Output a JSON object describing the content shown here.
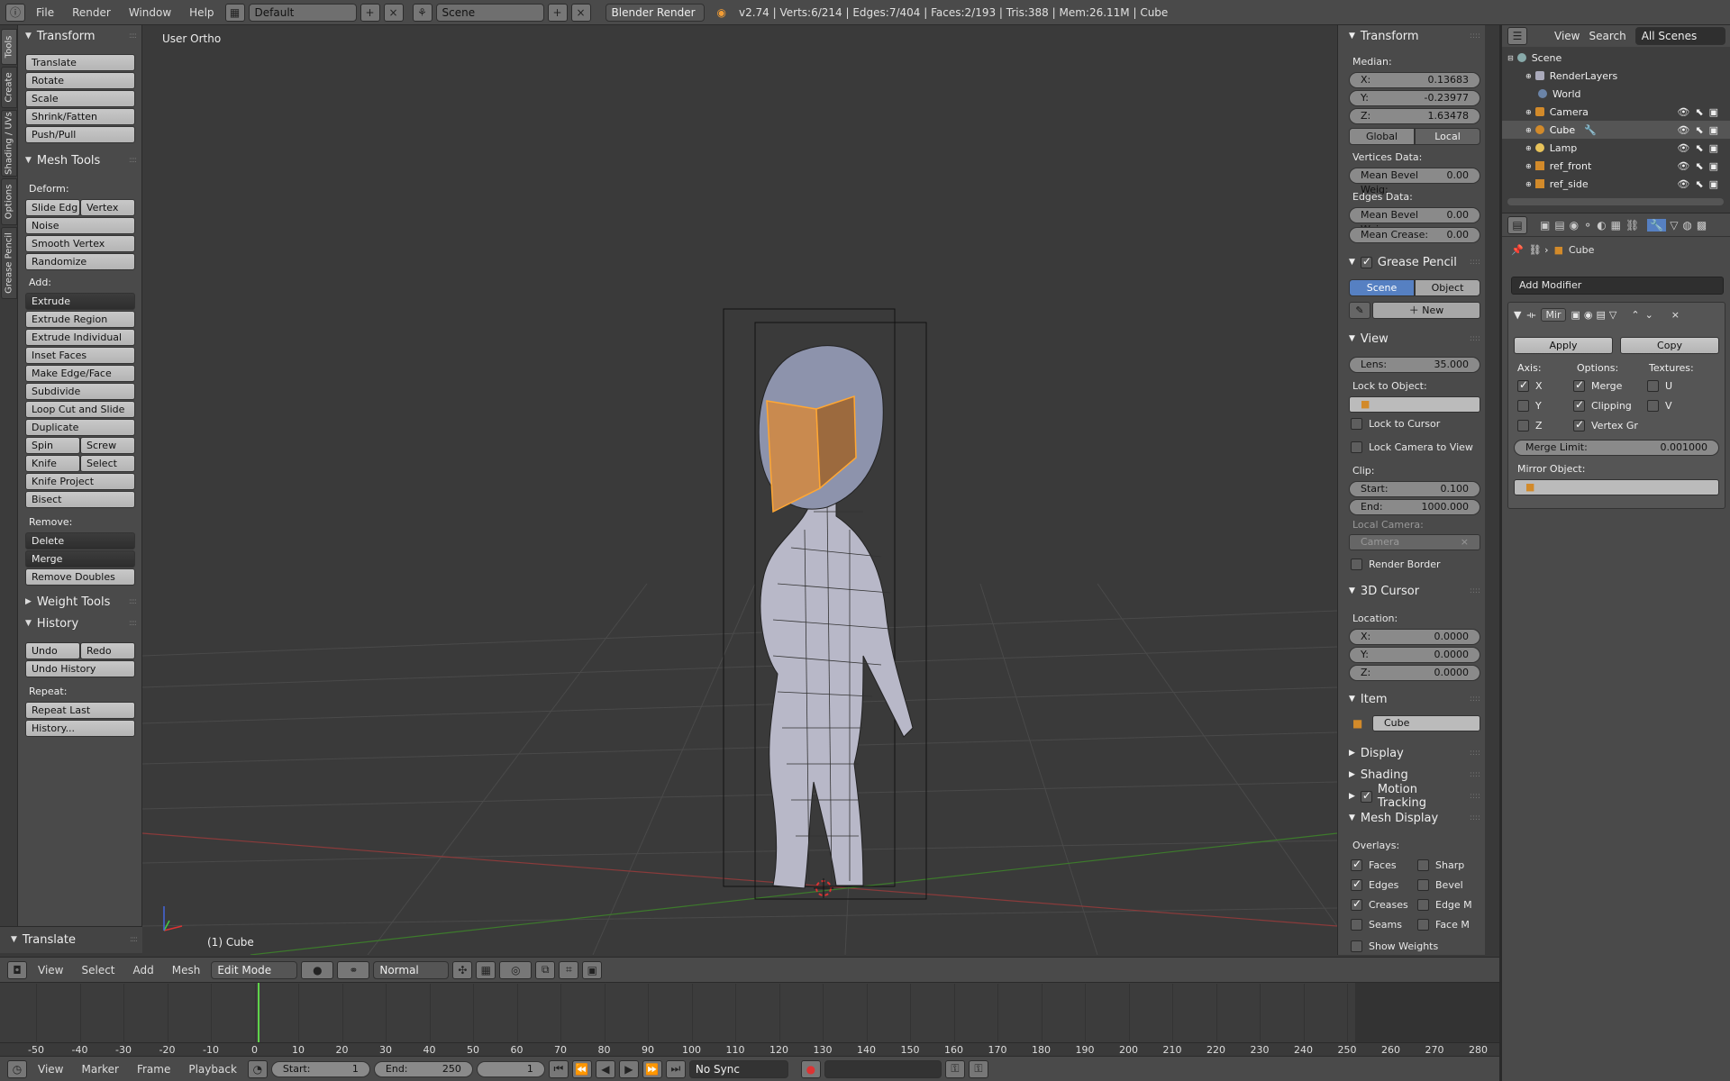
{
  "topbar": {
    "menus": [
      "File",
      "Render",
      "Window",
      "Help"
    ],
    "layout": "Default",
    "scene": "Scene",
    "engine": "Blender Render",
    "stats": "v2.74 | Verts:6/214 | Edges:7/404 | Faces:2/193 | Tris:388 | Mem:26.11M | Cube"
  },
  "left_tabs": [
    "Tools",
    "Create",
    "Shading / UVs",
    "Options",
    "Grease Pencil"
  ],
  "toolshelf": {
    "transform_title": "Transform",
    "transform": [
      "Translate",
      "Rotate",
      "Scale",
      "Shrink/Fatten",
      "Push/Pull"
    ],
    "mesh_tools_title": "Mesh Tools",
    "deform_label": "Deform:",
    "slide_edge": "Slide Edg",
    "vertex": "Vertex",
    "noise": "Noise",
    "smooth_vertex": "Smooth Vertex",
    "randomize": "Randomize",
    "add_label": "Add:",
    "extrude": "Extrude",
    "add_items": [
      "Extrude Region",
      "Extrude Individual",
      "Inset Faces",
      "Make Edge/Face",
      "Subdivide",
      "Loop Cut and Slide",
      "Duplicate"
    ],
    "spin": "Spin",
    "screw": "Screw",
    "knife": "Knife",
    "select": "Select",
    "knife_project": "Knife Project",
    "bisect": "Bisect",
    "remove_label": "Remove:",
    "delete": "Delete",
    "merge": "Merge",
    "remove_doubles": "Remove Doubles",
    "weight_tools_title": "Weight Tools",
    "history_title": "History",
    "undo": "Undo",
    "redo": "Redo",
    "undo_history": "Undo History",
    "repeat_label": "Repeat:",
    "repeat_last": "Repeat Last",
    "history_more": "History...",
    "operator_title": "Translate"
  },
  "viewport": {
    "view_label": "User Ortho",
    "object_label": "(1) Cube"
  },
  "npanel": {
    "transform_title": "Transform",
    "median_label": "Median:",
    "x_label": "X:",
    "x": "0.13683",
    "y_label": "Y:",
    "y": "-0.23977",
    "z_label": "Z:",
    "z": "1.63478",
    "global": "Global",
    "local": "Local",
    "vertices_data": "Vertices Data:",
    "v_bevel_label": "Mean Bevel Weig:",
    "v_bevel": "0.00",
    "edges_data": "Edges Data:",
    "e_bevel_label": "Mean Bevel Weig:",
    "e_bevel": "0.00",
    "crease_label": "Mean Crease:",
    "crease": "0.00",
    "grease_title": "Grease Pencil",
    "gp_scene": "Scene",
    "gp_object": "Object",
    "gp_new": "New",
    "view_title": "View",
    "lens_label": "Lens:",
    "lens": "35.000",
    "lock_obj": "Lock to Object:",
    "lock_cursor": "Lock to Cursor",
    "lock_camera": "Lock Camera to View",
    "clip_label": "Clip:",
    "start_label": "Start:",
    "start": "0.100",
    "end_label": "End:",
    "end": "1000.000",
    "local_camera": "Local Camera:",
    "camera": "Camera",
    "render_border": "Render Border",
    "cursor_title": "3D Cursor",
    "location_label": "Location:",
    "cx_label": "X:",
    "cx": "0.0000",
    "cy_label": "Y:",
    "cy": "0.0000",
    "cz_label": "Z:",
    "cz": "0.0000",
    "item_title": "Item",
    "item_name": "Cube",
    "display_title": "Display",
    "shading_title": "Shading",
    "motion_title": "Motion Tracking",
    "mesh_display_title": "Mesh Display",
    "overlays_label": "Overlays:",
    "faces": "Faces",
    "sharp": "Sharp",
    "edges": "Edges",
    "bevel": "Bevel",
    "creases": "Creases",
    "edge_m": "Edge M",
    "seams": "Seams",
    "face_m": "Face M",
    "show_weights": "Show Weights"
  },
  "outliner": {
    "view": "View",
    "search": "Search",
    "filter": "All Scenes",
    "items": [
      "Scene",
      "RenderLayers",
      "World",
      "Camera",
      "Cube",
      "Lamp",
      "ref_front",
      "ref_side"
    ]
  },
  "properties": {
    "object_name": "Cube",
    "add_modifier": "Add Modifier",
    "modifier_name": "Mir",
    "apply": "Apply",
    "copy": "Copy",
    "axis_label": "Axis:",
    "options_label": "Options:",
    "textures_label": "Textures:",
    "x": "X",
    "y": "Y",
    "z": "Z",
    "merge": "Merge",
    "clipping": "Clipping",
    "vertex_gr": "Vertex Gr",
    "u": "U",
    "v": "V",
    "merge_limit_label": "Merge Limit:",
    "merge_limit": "0.001000",
    "mirror_object": "Mirror Object:"
  },
  "vp_header": {
    "menus": [
      "View",
      "Select",
      "Add",
      "Mesh"
    ],
    "mode": "Edit Mode",
    "pivot": "Normal"
  },
  "timeline": {
    "ticks": [
      "-50",
      "-40",
      "-30",
      "-20",
      "-10",
      "0",
      "10",
      "20",
      "30",
      "40",
      "50",
      "60",
      "70",
      "80",
      "90",
      "100",
      "110",
      "120",
      "130",
      "140",
      "150",
      "160",
      "170",
      "180",
      "190",
      "200",
      "210",
      "220",
      "230",
      "240",
      "250",
      "260",
      "270",
      "280"
    ],
    "current_frame": 1
  },
  "tl_header": {
    "menus": [
      "View",
      "Marker",
      "Frame",
      "Playback"
    ],
    "start_label": "Start:",
    "start": "1",
    "end_label": "End:",
    "end": "250",
    "frame": "1",
    "sync": "No Sync"
  },
  "colors": {
    "selected_face": "#c98a4f",
    "selected_edge": "#ffa733",
    "accent": "#5680c2"
  }
}
